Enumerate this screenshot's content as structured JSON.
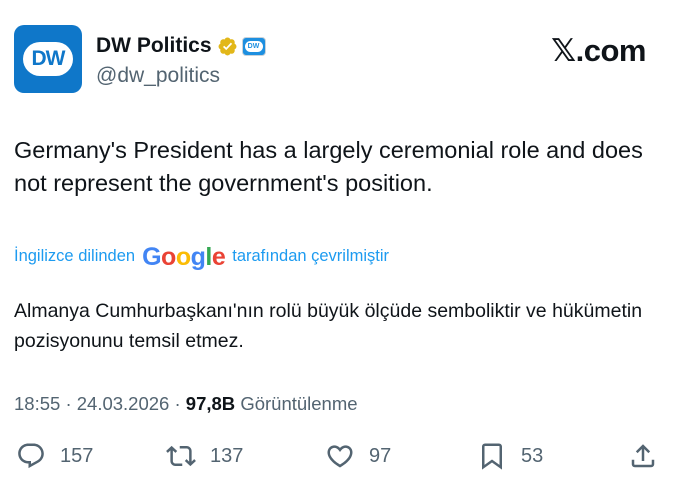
{
  "account": {
    "avatar_text": "DW",
    "display_name": "DW Politics",
    "handle": "@dw_politics",
    "affiliation_badge": "DW"
  },
  "brand": "𝕏.com",
  "tweet": {
    "text": "Germany's President has a largely ceremonial role and does not represent the government's position."
  },
  "translation": {
    "prefix": "İngilizce dilinden",
    "provider": "Google",
    "suffix": "tarafından çevrilmiştir",
    "text": "Almanya Cumhurbaşkanı'nın rolü büyük ölçüde semboliktir ve hükümetin pozisyonunu temsil etmez."
  },
  "meta": {
    "time": "18:55",
    "date": "24.03.2026",
    "views": "97,8B",
    "views_label": "Görüntülenme"
  },
  "actions": {
    "replies": "157",
    "reposts": "137",
    "likes": "97",
    "bookmarks": "53"
  },
  "colors": {
    "dw_blue": "#0f77c9",
    "link_blue": "#1d9bf0",
    "secondary_text": "#536471",
    "verified_gold": "#e2b719"
  },
  "icons": [
    "verified-badge-icon",
    "reply-icon",
    "repost-icon",
    "like-icon",
    "bookmark-icon",
    "share-icon"
  ]
}
